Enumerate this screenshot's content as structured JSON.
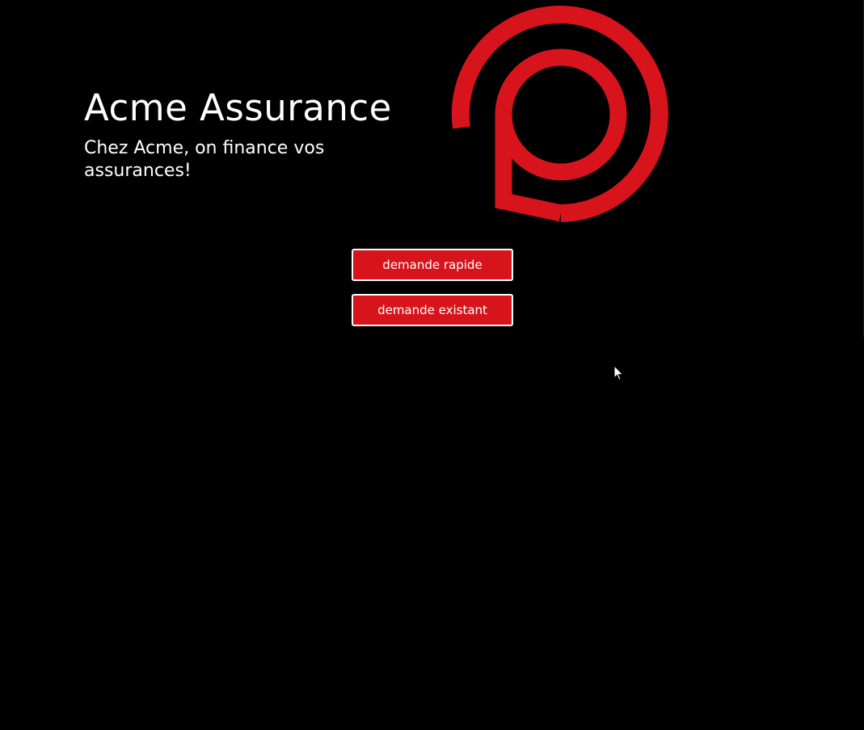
{
  "hero": {
    "title": "Acme Assurance",
    "subtitle": "Chez Acme, on finance vos assurances!"
  },
  "brand": {
    "accent_color": "#d7141b",
    "logo_icon": "brand-p-logo-icon"
  },
  "actions": {
    "quick_request_label": "demande rapide",
    "existing_request_label": "demande existant"
  },
  "pointer": {
    "icon": "mouse-cursor-icon"
  }
}
